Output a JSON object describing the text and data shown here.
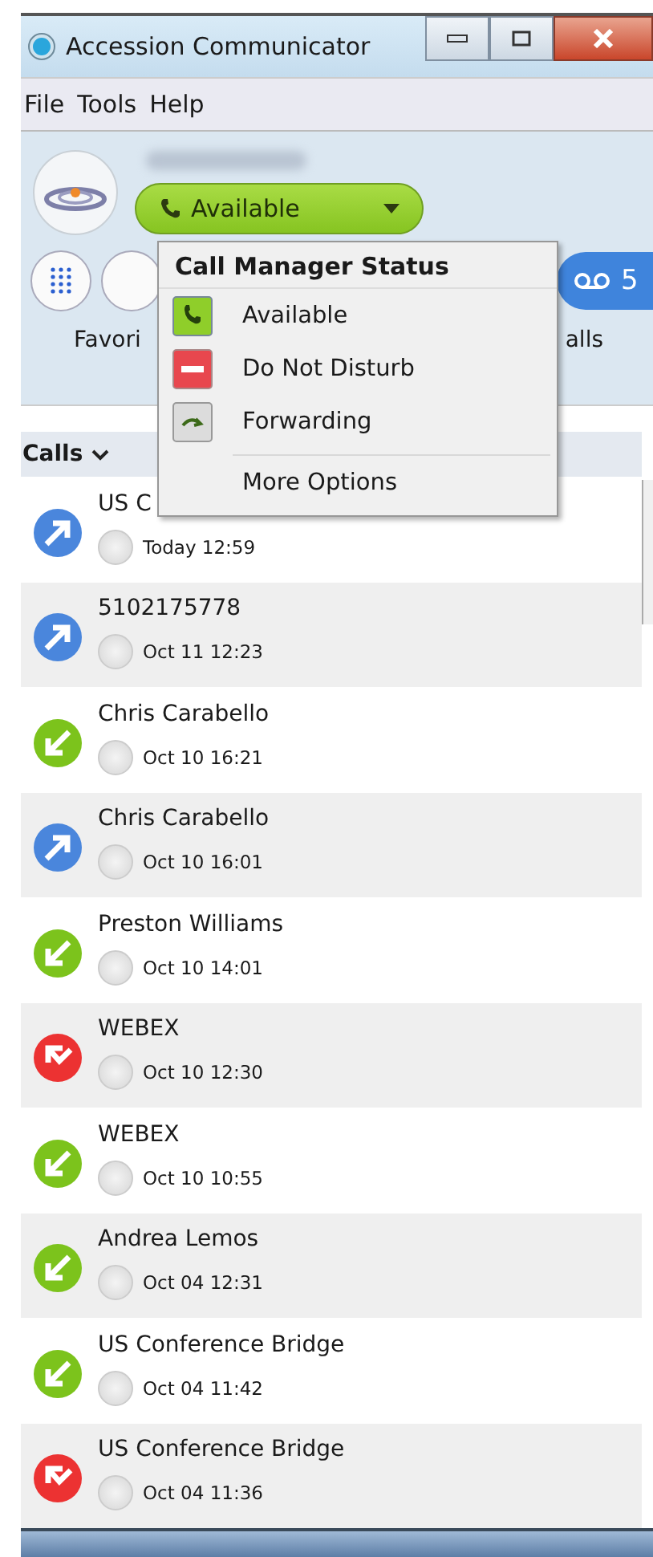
{
  "window": {
    "title": "Accession Communicator"
  },
  "menu_bar": [
    "File",
    "Tools",
    "Help"
  ],
  "status_button": {
    "label": "Available"
  },
  "tabs": [
    {
      "label": "Favori"
    },
    {
      "label": "alls"
    }
  ],
  "voicemail": {
    "count": "5"
  },
  "status_menu": {
    "title": "Call Manager Status",
    "items": [
      {
        "kind": "available",
        "label": "Available"
      },
      {
        "kind": "dnd",
        "label": "Do Not Disturb"
      },
      {
        "kind": "forwarding",
        "label": "Forwarding"
      }
    ],
    "more": "More Options"
  },
  "calls_header": "Calls",
  "calls": [
    {
      "kind": "outgoing",
      "name": "US C",
      "time": "Today 12:59"
    },
    {
      "kind": "outgoing",
      "name": "5102175778",
      "time": "Oct 11 12:23"
    },
    {
      "kind": "incoming",
      "name": "Chris Carabello",
      "time": "Oct 10 16:21"
    },
    {
      "kind": "outgoing",
      "name": "Chris Carabello",
      "time": "Oct 10 16:01"
    },
    {
      "kind": "incoming",
      "name": "Preston Williams",
      "time": "Oct 10 14:01"
    },
    {
      "kind": "missed",
      "name": "WEBEX",
      "time": "Oct 10 12:30"
    },
    {
      "kind": "incoming",
      "name": "WEBEX",
      "time": "Oct 10 10:55"
    },
    {
      "kind": "incoming",
      "name": "Andrea Lemos",
      "time": "Oct 04 12:31"
    },
    {
      "kind": "incoming",
      "name": "US Conference Bridge",
      "time": "Oct 04 11:42"
    },
    {
      "kind": "missed",
      "name": "US Conference Bridge",
      "time": "Oct 04 11:36"
    }
  ]
}
